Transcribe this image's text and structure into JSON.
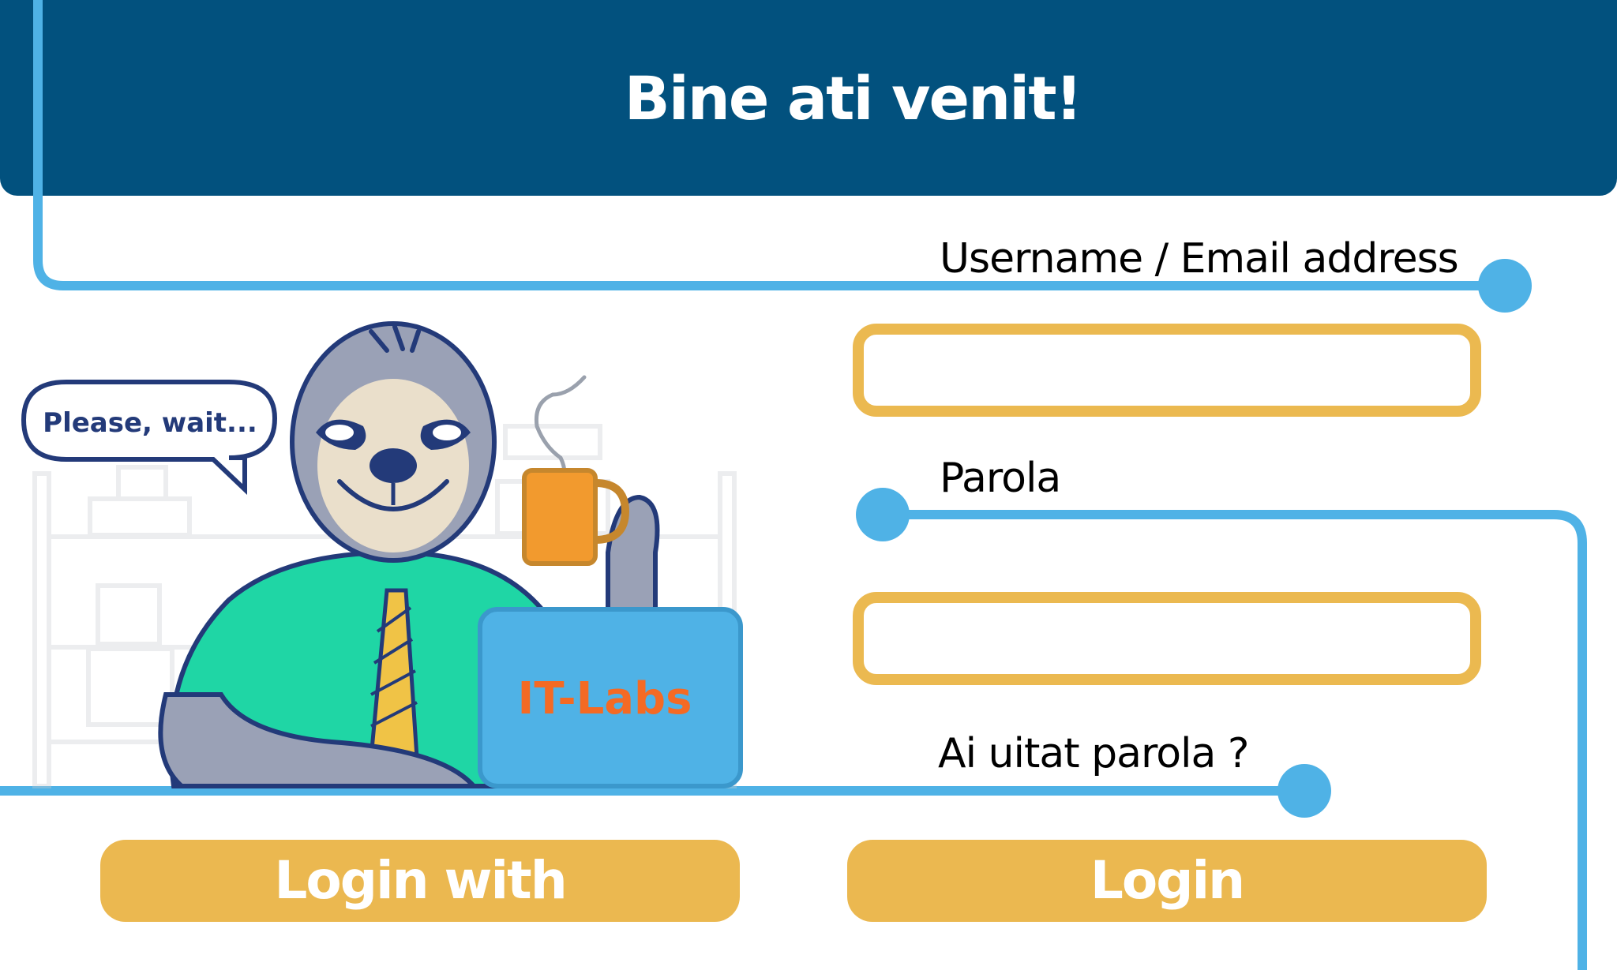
{
  "header": {
    "title": "Bine ati venit!"
  },
  "form": {
    "username_label": "Username / Email address",
    "username_value": "",
    "password_label": "Parola",
    "password_value": "",
    "forgot_link": "Ai uitat parola ?"
  },
  "buttons": {
    "social_login_label": "Login  with",
    "login_label": "Login"
  },
  "illustration": {
    "speech_bubble": "Please, wait...",
    "laptop_brand": "IT-Labs",
    "character": "sloth-icon"
  },
  "colors": {
    "header_bg": "#02517e",
    "accent_line": "#4fb2e6",
    "field_border": "#ebb950",
    "button_bg": "#ebb850"
  }
}
